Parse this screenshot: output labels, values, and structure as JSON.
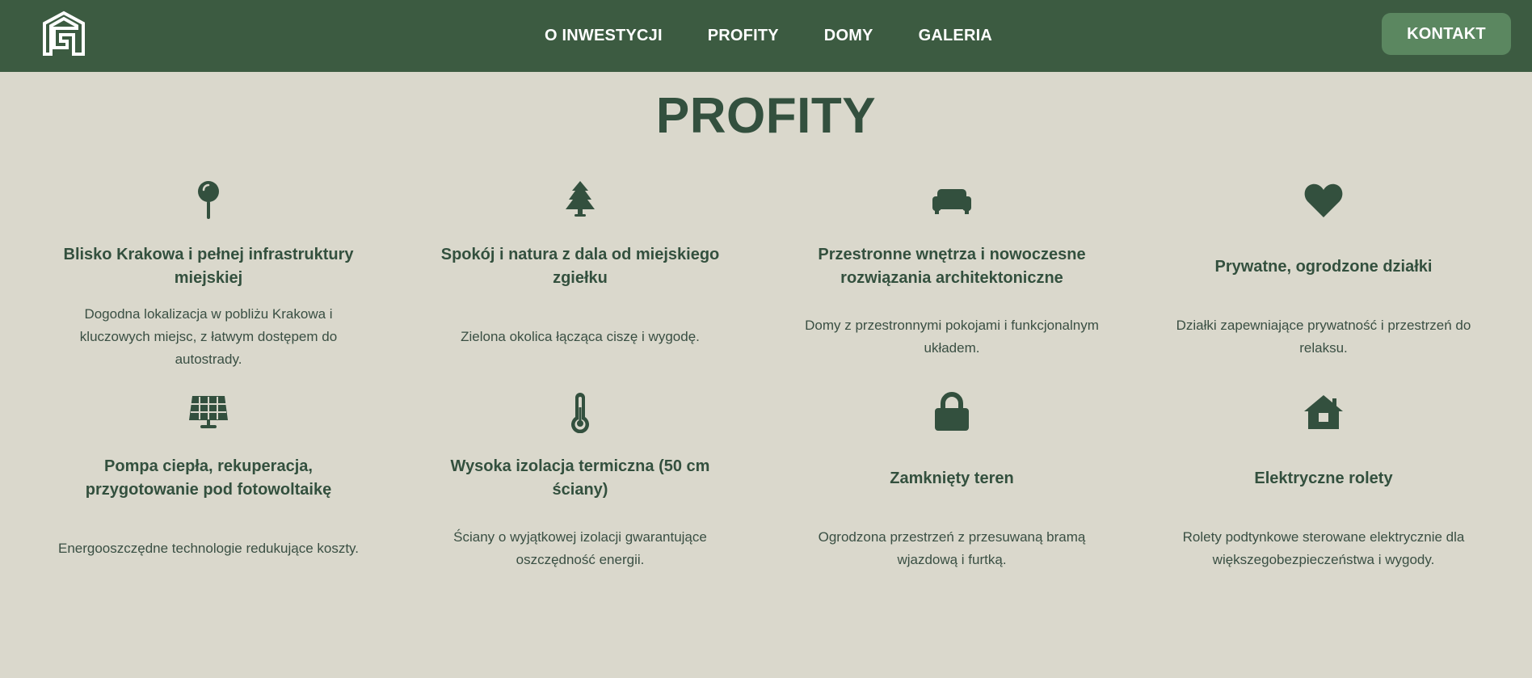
{
  "nav": {
    "items": [
      "O INWESTYCJI",
      "PROFITY",
      "DOMY",
      "GALERIA"
    ],
    "cta_label": "KONTAKT"
  },
  "section": {
    "title": "PROFITY"
  },
  "features": [
    {
      "icon": "map-pin-icon",
      "title": "Blisko Krakowa i pełnej infrastruktury miejskiej",
      "description": "Dogodna lokalizacja w pobliżu Krakowa i kluczowych miejsc, z łatwym dostępem do autostrady."
    },
    {
      "icon": "tree-icon",
      "title": "Spokój i natura z dala od miejskiego zgiełku",
      "description": "Zielona okolica łącząca ciszę i wygodę."
    },
    {
      "icon": "couch-icon",
      "title": "Przestronne wnętrza i nowoczesne rozwiązania architektoniczne",
      "description": "Domy z przestronnymi pokojami i funkcjonalnym układem."
    },
    {
      "icon": "heart-icon",
      "title": "Prywatne, ogrodzone działki",
      "description": "Działki zapewniające prywatność i przestrzeń do relaksu."
    },
    {
      "icon": "solar-panel-icon",
      "title": "Pompa ciepła, rekuperacja, przygotowanie pod fotowoltaikę",
      "description": "Energooszczędne technologie redukujące koszty."
    },
    {
      "icon": "thermometer-icon",
      "title": "Wysoka izolacja termiczna (50 cm ściany)",
      "description": "Ściany o wyjątkowej izolacji gwarantujące oszczędność energii."
    },
    {
      "icon": "lock-icon",
      "title": "Zamknięty teren",
      "description": "Ogrodzona przestrzeń z przesuwaną bramą wjazdową i furtką."
    },
    {
      "icon": "house-icon",
      "title": "Elektryczne rolety",
      "description": "Rolety podtynkowe sterowane elektrycznie dla większegobezpieczeństwa i wygody."
    }
  ],
  "colors": {
    "header_bg": "#3c5b41",
    "page_bg": "#dad8cc",
    "cta_bg": "#5b8760",
    "text_dark": "#33503e"
  }
}
